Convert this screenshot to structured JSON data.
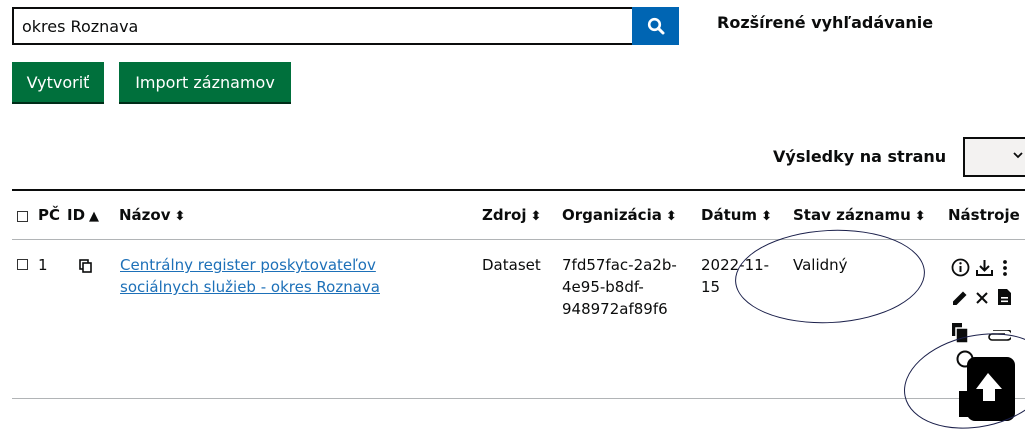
{
  "search": {
    "value": "okres Roznava",
    "advanced_label": "Rozšírené vyhľadávanie"
  },
  "actions": {
    "create_label": "Vytvoriť",
    "import_label": "Import záznamov"
  },
  "pagination": {
    "per_page_label": "Výsledky na stranu",
    "per_page_value": ""
  },
  "table": {
    "headers": {
      "index": "PČ",
      "id": "ID",
      "name": "Názov",
      "source": "Zdroj",
      "organization": "Organizácia",
      "date": "Dátum",
      "status": "Stav záznamu",
      "tools": "Nástroje"
    },
    "rows": [
      {
        "index": "1",
        "name_line1": "Centrálny register poskytovateľov",
        "name_line2": "sociálnych služieb - okres Roznava",
        "source": "Dataset",
        "org_line1": "7fd57fac-2a2b-",
        "org_line2": "4e95-b8df-",
        "org_line3": "948972af89f6",
        "date_line1": "2022-11-",
        "date_line2": "15",
        "status": "Validný"
      }
    ]
  },
  "colors": {
    "search_button": "#0065b3",
    "primary_button": "#00703c",
    "link": "#1d70b8",
    "annotation_oval": "#1a1f4a"
  },
  "icons": [
    "search-icon",
    "copy-icon",
    "info-icon",
    "download-icon",
    "more-vertical-icon",
    "edit-icon",
    "close-icon",
    "document-icon",
    "duplicate-icon",
    "attachment-icon",
    "history-icon",
    "upload-icon"
  ]
}
